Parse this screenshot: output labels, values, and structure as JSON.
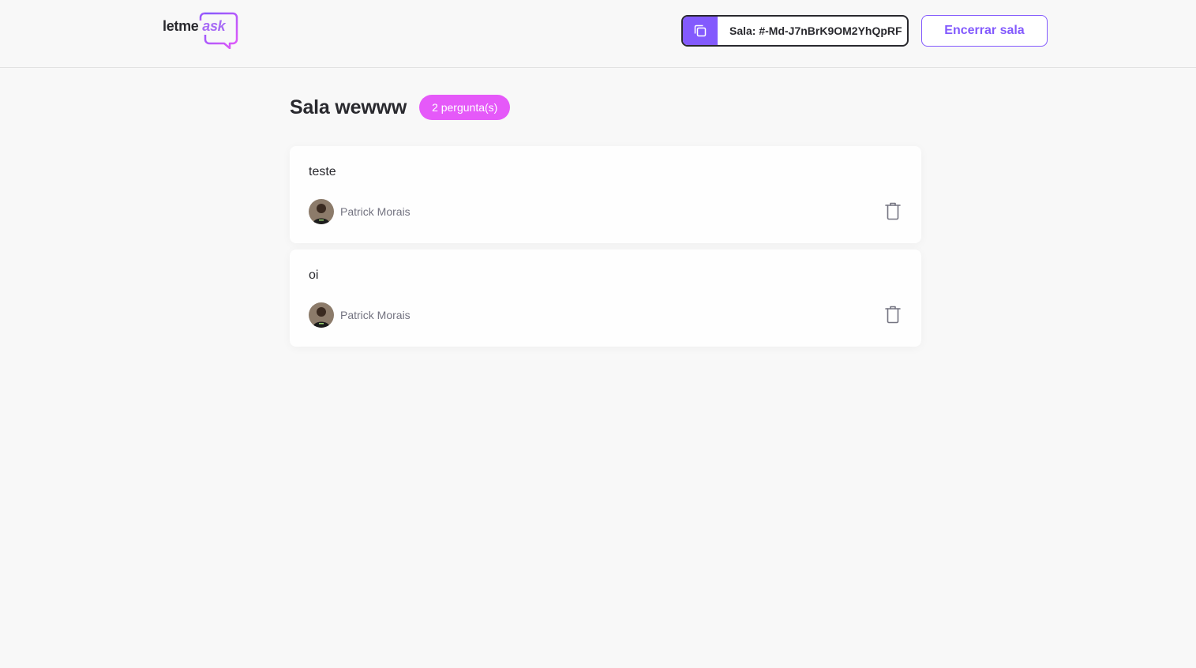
{
  "header": {
    "logo": {
      "text_main": "letme",
      "text_accent": "ask"
    },
    "room_code": {
      "label": "Sala: #-Md-J7nBrK9OM2YhQpRF",
      "icon": "copy-icon"
    },
    "close_room_label": "Encerrar sala"
  },
  "room": {
    "title": "Sala wewww",
    "question_count": "2 pergunta(s)"
  },
  "questions": [
    {
      "content": "teste",
      "author": "Patrick Morais",
      "action_icon": "trash-icon"
    },
    {
      "content": "oi",
      "author": "Patrick Morais",
      "action_icon": "trash-icon"
    }
  ],
  "colors": {
    "primary": "#835afd",
    "badge": "#e559f9",
    "text": "#29292e",
    "muted": "#737380",
    "background": "#f8f8f8"
  }
}
